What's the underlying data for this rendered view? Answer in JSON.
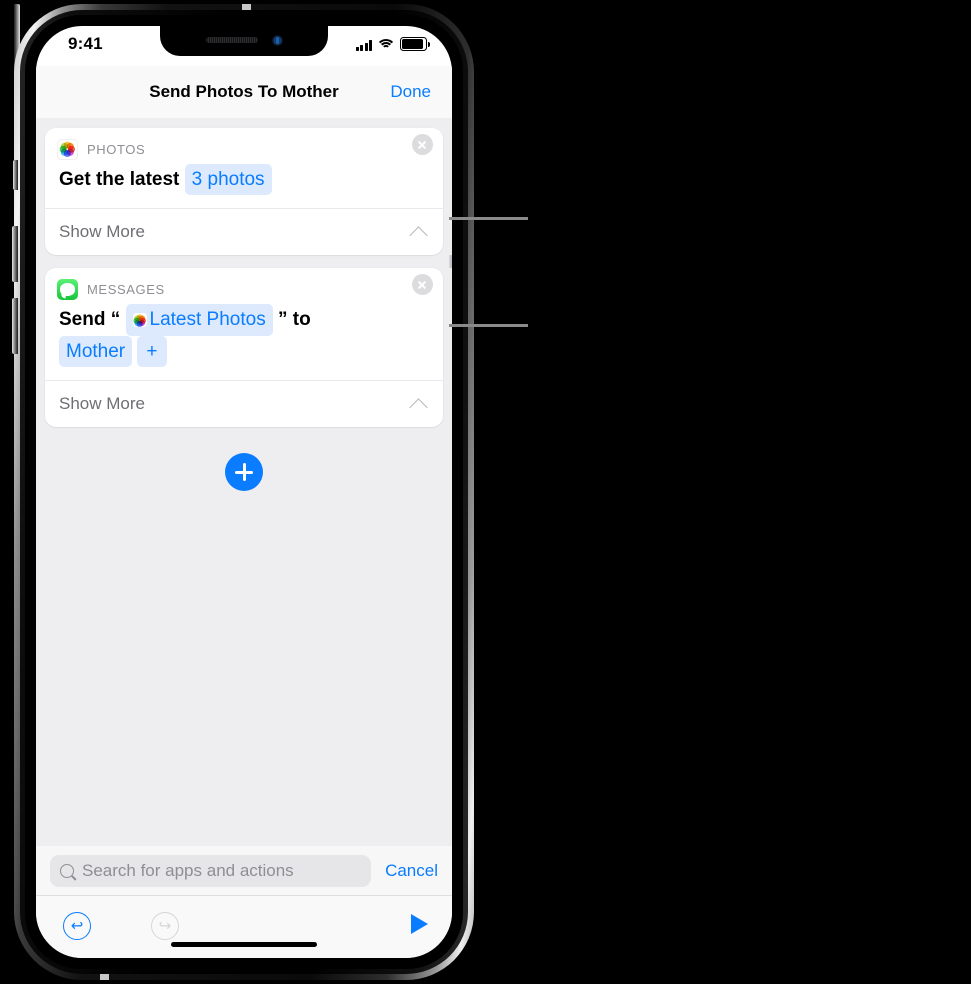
{
  "status_bar": {
    "time": "9:41",
    "signal_icon": "cellular-bars-icon",
    "wifi_icon": "wifi-icon",
    "battery_icon": "battery-full-icon"
  },
  "nav": {
    "title": "Send Photos To Mother",
    "done_label": "Done"
  },
  "actions": [
    {
      "app_name": "PHOTOS",
      "app_icon": "photos-app-icon",
      "remove_icon": "remove-action-icon",
      "text_before": "Get the latest",
      "token": "3 photos",
      "show_more_label": "Show More",
      "chevron_icon": "chevron-up-icon"
    },
    {
      "app_name": "MESSAGES",
      "app_icon": "messages-app-icon",
      "remove_icon": "remove-action-icon",
      "text_before": "Send",
      "quote_open": "“",
      "token_photos": "Latest Photos",
      "quote_close": "”",
      "text_middle": "to",
      "token_recipient": "Mother",
      "token_add": "+",
      "show_more_label": "Show More",
      "chevron_icon": "chevron-up-icon"
    }
  ],
  "add_action": {
    "icon": "plus-icon",
    "label": "+"
  },
  "search": {
    "placeholder": "Search for apps and actions",
    "icon": "search-icon",
    "cancel_label": "Cancel"
  },
  "toolbar": {
    "undo_icon": "undo-icon",
    "undo_glyph": "↩",
    "redo_icon": "redo-icon",
    "redo_glyph": "↪",
    "play_icon": "play-icon"
  },
  "colors": {
    "accent": "#0a7cff",
    "token_bg": "#ddeafd",
    "muted": "#8e8e93"
  }
}
